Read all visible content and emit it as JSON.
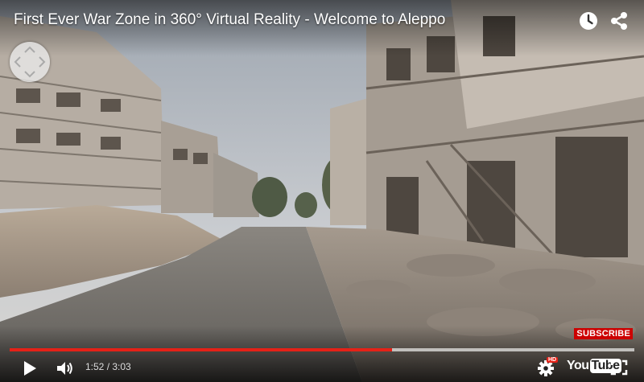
{
  "video": {
    "title": "First Ever War Zone in 360° Virtual Reality - Welcome to Aleppo",
    "current_time": "1:52",
    "duration": "3:03",
    "time_separator": " / ",
    "played_fraction": 0.612,
    "buffered_fraction": 1.0
  },
  "overlay": {
    "subscribe_label": "SUBSCRIBE"
  },
  "controls": {
    "youtube_logo_you": "You",
    "youtube_logo_tube": "Tube",
    "hd_badge": "HD"
  },
  "colors": {
    "progress_played": "#e52117",
    "subscribe_bg": "#cc0000"
  },
  "icons": {
    "watch_later": "clock-icon",
    "share": "share-icon",
    "pan": "pan-arrows-icon",
    "play": "play-icon",
    "volume": "volume-icon",
    "settings": "gear-icon",
    "fullscreen": "fullscreen-icon"
  }
}
